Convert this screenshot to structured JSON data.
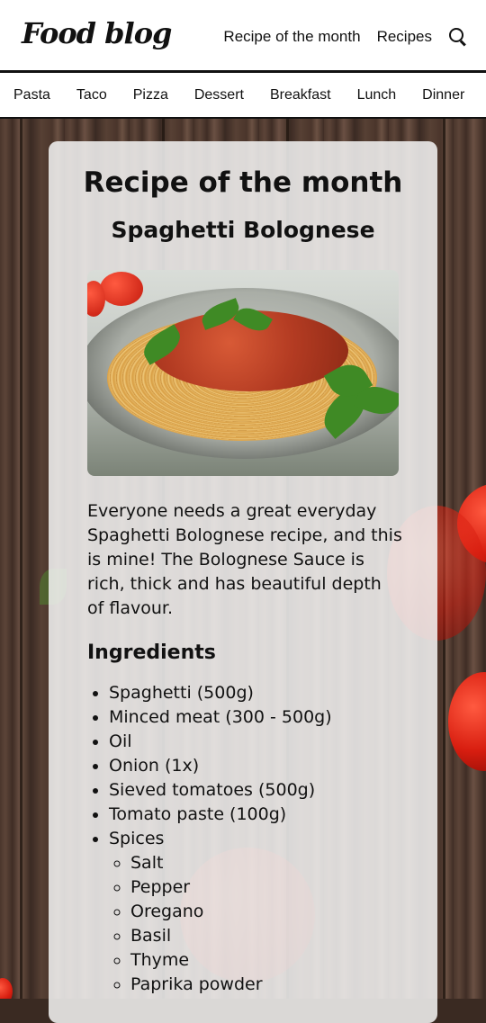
{
  "header": {
    "logo": "Food blog",
    "nav": [
      {
        "label": "Recipe of the month"
      },
      {
        "label": "Recipes"
      }
    ],
    "search_icon": "search-icon"
  },
  "categories": [
    "Pasta",
    "Taco",
    "Pizza",
    "Dessert",
    "Breakfast",
    "Lunch",
    "Dinner"
  ],
  "card": {
    "title": "Recipe of the month",
    "recipe_name": "Spaghetti Bolognese",
    "description": "Everyone needs a great everyday Spaghetti Bolognese recipe, and this is mine! The Bolognese Sauce is rich, thick and has beautiful depth of flavour.",
    "ingredients_title": "Ingredients",
    "ingredients": [
      "Spaghetti (500g)",
      "Minced meat (300 - 500g)",
      "Oil",
      "Onion (1x)",
      "Sieved tomatoes (500g)",
      "Tomato paste (100g)",
      "Spices"
    ],
    "spices": [
      "Salt",
      "Pepper",
      "Oregano",
      "Basil",
      "Thyme",
      "Paprika powder"
    ]
  },
  "colors": {
    "text": "#111111",
    "card_bg": "#f5f5f5",
    "wood": "#4a362c",
    "tomato": "#d81e10"
  }
}
